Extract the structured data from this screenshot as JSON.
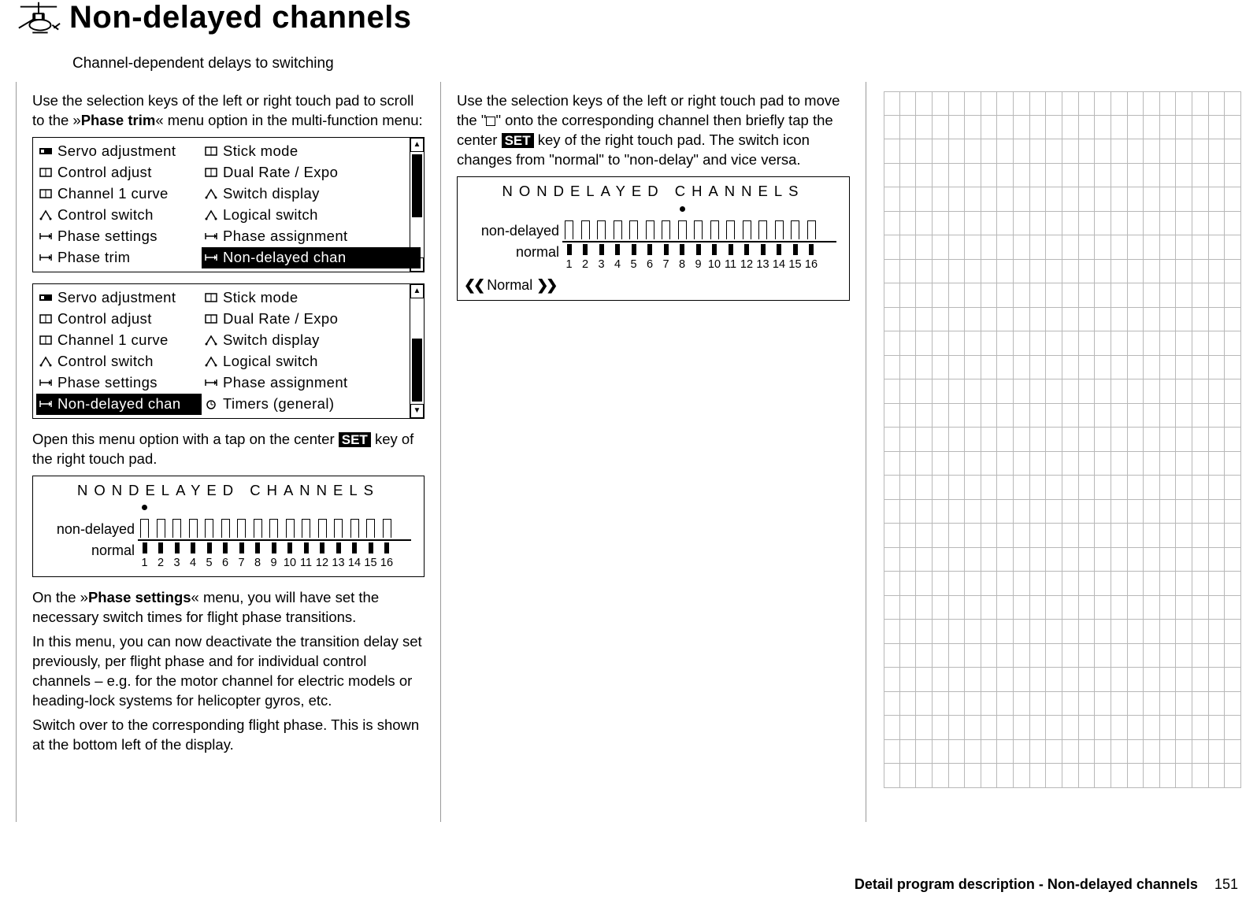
{
  "header": {
    "title": "Non-delayed channels",
    "subtitle": "Channel-dependent delays to switching"
  },
  "col1": {
    "p1a": "Use the selection keys of the left or right touch pad to scroll to the »",
    "p1b": "Phase trim",
    "p1c": "« menu option in the multi-function menu:",
    "menu1": {
      "left": [
        "Servo adjustment",
        "Control adjust",
        "Channel 1 curve",
        "Control switch",
        "Phase settings",
        "Phase trim"
      ],
      "right": [
        "Stick mode",
        "Dual Rate / Expo",
        "Switch display",
        "Logical switch",
        "Phase assignment",
        "Non-delayed chan"
      ],
      "selected_right_index": 5,
      "thumb_top_pct": 2,
      "thumb_h_pct": 60
    },
    "menu2": {
      "left": [
        "Servo adjustment",
        "Control adjust",
        "Channel 1 curve",
        "Control switch",
        "Phase settings",
        "Non-delayed chan"
      ],
      "right": [
        "Stick mode",
        "Dual Rate / Expo",
        "Switch display",
        "Logical switch",
        "Phase assignment",
        "Timers (general)"
      ],
      "selected_left_index": 5,
      "thumb_top_pct": 38,
      "thumb_h_pct": 60
    },
    "p2a": "Open this menu option with a tap on the center ",
    "p2_set": "SET",
    "p2b": " key of the right touch pad.",
    "screen1": {
      "title": "NONDELAYED CHANNELS",
      "row_top": "non-delayed",
      "row_bot": "normal",
      "cursor_channel": 1,
      "channels": [
        "1",
        "2",
        "3",
        "4",
        "5",
        "6",
        "7",
        "8",
        "9",
        "10",
        "11",
        "12",
        "13",
        "14",
        "15",
        "16"
      ]
    },
    "p3a": "On the »",
    "p3b": "Phase settings",
    "p3c": "« menu, you will have set the necessary switch times for flight phase transitions.",
    "p4": "In this menu, you can now deactivate the transition delay set previously, per flight phase and for individual control channels – e.g. for the motor channel for electric models or heading-lock systems for helicopter gyros, etc.",
    "p5": "Switch over to the corresponding flight phase. This is shown at the bottom left of the display."
  },
  "col2": {
    "p1a": "Use the selection keys of the left or right touch pad to move the \"",
    "p1b": "\" onto the corresponding channel then briefly tap the center ",
    "p1_set": "SET",
    "p1c": " key of the right touch pad. The switch icon changes from \"normal\" to \"non-delay\" and vice versa.",
    "screen2": {
      "title": "NONDELAYED CHANNELS",
      "row_top": "non-delayed",
      "row_bot": "normal",
      "cursor_channel": 8,
      "channels": [
        "1",
        "2",
        "3",
        "4",
        "5",
        "6",
        "7",
        "8",
        "9",
        "10",
        "11",
        "12",
        "13",
        "14",
        "15",
        "16"
      ],
      "footer_label": "Normal"
    }
  },
  "footer": {
    "text": "Detail program description - Non-delayed channels",
    "page": "151"
  }
}
